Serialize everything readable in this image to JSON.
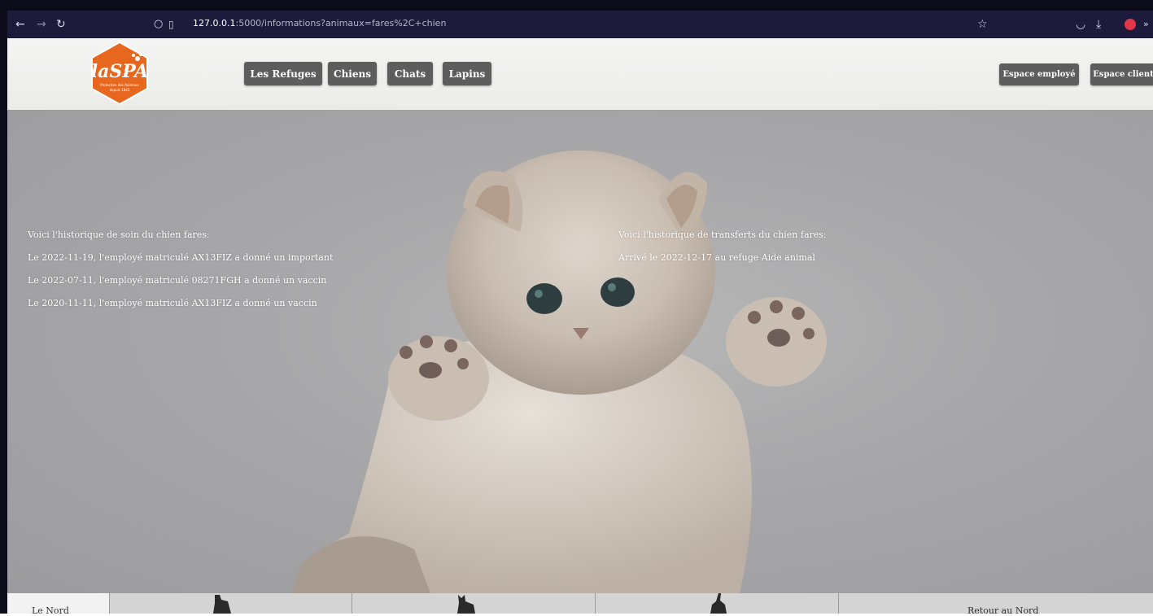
{
  "browser": {
    "url_host": "127.0.0.1",
    "url_rest": ":5000/informations?animaux=fares%2C+chien"
  },
  "header": {
    "nav": [
      "Les Refuges",
      "Chiens",
      "Chats",
      "Lapins"
    ],
    "espace_employe": "Espace employé",
    "espace_client": "Espace client",
    "logo_text": "laSPA",
    "logo_tagline": "Protection des Animaux depuis 1845"
  },
  "soins": {
    "title": "Voici l'historique de soin du chien fares:",
    "lines": [
      "Le 2022-11-19, l'employé matriculé AX13FIZ a donné un important",
      "Le 2022-07-11, l'employé matriculé 08271FGH a donné un vaccin",
      "Le 2020-11-11, l'employé matriculé AX13FIZ a donné un vaccin"
    ]
  },
  "transferts": {
    "title": "Voici l'historique de transferts du chien fares:",
    "lines": [
      "Arrivé le 2022-12-17 au refuge Aide animal"
    ]
  },
  "bottom": {
    "left_label": "Le Nord",
    "right_label": "Retour au Nord"
  }
}
